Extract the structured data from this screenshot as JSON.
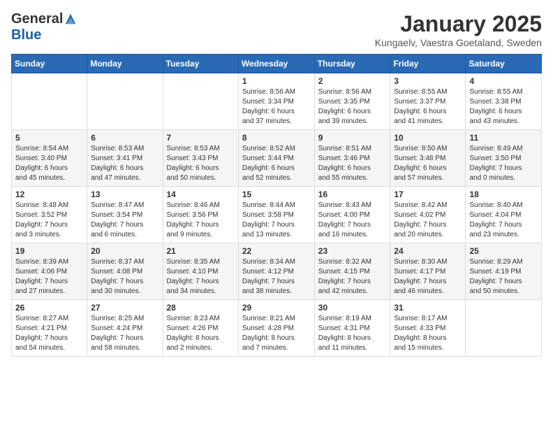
{
  "logo": {
    "general": "General",
    "blue": "Blue"
  },
  "title": "January 2025",
  "location": "Kungaelv, Vaestra Goetaland, Sweden",
  "weekdays": [
    "Sunday",
    "Monday",
    "Tuesday",
    "Wednesday",
    "Thursday",
    "Friday",
    "Saturday"
  ],
  "weeks": [
    [
      {
        "day": "",
        "info": ""
      },
      {
        "day": "",
        "info": ""
      },
      {
        "day": "",
        "info": ""
      },
      {
        "day": "1",
        "info": "Sunrise: 8:56 AM\nSunset: 3:34 PM\nDaylight: 6 hours\nand 37 minutes."
      },
      {
        "day": "2",
        "info": "Sunrise: 8:56 AM\nSunset: 3:35 PM\nDaylight: 6 hours\nand 39 minutes."
      },
      {
        "day": "3",
        "info": "Sunrise: 8:55 AM\nSunset: 3:37 PM\nDaylight: 6 hours\nand 41 minutes."
      },
      {
        "day": "4",
        "info": "Sunrise: 8:55 AM\nSunset: 3:38 PM\nDaylight: 6 hours\nand 43 minutes."
      }
    ],
    [
      {
        "day": "5",
        "info": "Sunrise: 8:54 AM\nSunset: 3:40 PM\nDaylight: 6 hours\nand 45 minutes."
      },
      {
        "day": "6",
        "info": "Sunrise: 8:53 AM\nSunset: 3:41 PM\nDaylight: 6 hours\nand 47 minutes."
      },
      {
        "day": "7",
        "info": "Sunrise: 8:53 AM\nSunset: 3:43 PM\nDaylight: 6 hours\nand 50 minutes."
      },
      {
        "day": "8",
        "info": "Sunrise: 8:52 AM\nSunset: 3:44 PM\nDaylight: 6 hours\nand 52 minutes."
      },
      {
        "day": "9",
        "info": "Sunrise: 8:51 AM\nSunset: 3:46 PM\nDaylight: 6 hours\nand 55 minutes."
      },
      {
        "day": "10",
        "info": "Sunrise: 8:50 AM\nSunset: 3:48 PM\nDaylight: 6 hours\nand 57 minutes."
      },
      {
        "day": "11",
        "info": "Sunrise: 8:49 AM\nSunset: 3:50 PM\nDaylight: 7 hours\nand 0 minutes."
      }
    ],
    [
      {
        "day": "12",
        "info": "Sunrise: 8:48 AM\nSunset: 3:52 PM\nDaylight: 7 hours\nand 3 minutes."
      },
      {
        "day": "13",
        "info": "Sunrise: 8:47 AM\nSunset: 3:54 PM\nDaylight: 7 hours\nand 6 minutes."
      },
      {
        "day": "14",
        "info": "Sunrise: 8:46 AM\nSunset: 3:56 PM\nDaylight: 7 hours\nand 9 minutes."
      },
      {
        "day": "15",
        "info": "Sunrise: 8:44 AM\nSunset: 3:58 PM\nDaylight: 7 hours\nand 13 minutes."
      },
      {
        "day": "16",
        "info": "Sunrise: 8:43 AM\nSunset: 4:00 PM\nDaylight: 7 hours\nand 16 minutes."
      },
      {
        "day": "17",
        "info": "Sunrise: 8:42 AM\nSunset: 4:02 PM\nDaylight: 7 hours\nand 20 minutes."
      },
      {
        "day": "18",
        "info": "Sunrise: 8:40 AM\nSunset: 4:04 PM\nDaylight: 7 hours\nand 23 minutes."
      }
    ],
    [
      {
        "day": "19",
        "info": "Sunrise: 8:39 AM\nSunset: 4:06 PM\nDaylight: 7 hours\nand 27 minutes."
      },
      {
        "day": "20",
        "info": "Sunrise: 8:37 AM\nSunset: 4:08 PM\nDaylight: 7 hours\nand 30 minutes."
      },
      {
        "day": "21",
        "info": "Sunrise: 8:35 AM\nSunset: 4:10 PM\nDaylight: 7 hours\nand 34 minutes."
      },
      {
        "day": "22",
        "info": "Sunrise: 8:34 AM\nSunset: 4:12 PM\nDaylight: 7 hours\nand 38 minutes."
      },
      {
        "day": "23",
        "info": "Sunrise: 8:32 AM\nSunset: 4:15 PM\nDaylight: 7 hours\nand 42 minutes."
      },
      {
        "day": "24",
        "info": "Sunrise: 8:30 AM\nSunset: 4:17 PM\nDaylight: 7 hours\nand 46 minutes."
      },
      {
        "day": "25",
        "info": "Sunrise: 8:29 AM\nSunset: 4:19 PM\nDaylight: 7 hours\nand 50 minutes."
      }
    ],
    [
      {
        "day": "26",
        "info": "Sunrise: 8:27 AM\nSunset: 4:21 PM\nDaylight: 7 hours\nand 54 minutes."
      },
      {
        "day": "27",
        "info": "Sunrise: 8:25 AM\nSunset: 4:24 PM\nDaylight: 7 hours\nand 58 minutes."
      },
      {
        "day": "28",
        "info": "Sunrise: 8:23 AM\nSunset: 4:26 PM\nDaylight: 8 hours\nand 2 minutes."
      },
      {
        "day": "29",
        "info": "Sunrise: 8:21 AM\nSunset: 4:28 PM\nDaylight: 8 hours\nand 7 minutes."
      },
      {
        "day": "30",
        "info": "Sunrise: 8:19 AM\nSunset: 4:31 PM\nDaylight: 8 hours\nand 11 minutes."
      },
      {
        "day": "31",
        "info": "Sunrise: 8:17 AM\nSunset: 4:33 PM\nDaylight: 8 hours\nand 15 minutes."
      },
      {
        "day": "",
        "info": ""
      }
    ]
  ]
}
